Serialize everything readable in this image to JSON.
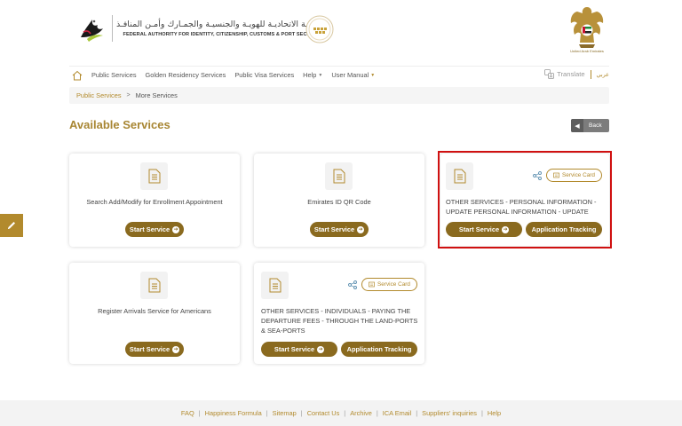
{
  "header": {
    "logo_arabic": "الهيئـة الاتحاديـة للهويـة والجنسيـة والجمـارك وأمـن المنافـذ",
    "logo_english": "FEDERAL AUTHORITY FOR IDENTITY, CITIZENSHIP, CUSTOMS & PORT SECURITY",
    "uae_label": "United Arab Emirates"
  },
  "nav": {
    "items": [
      {
        "label": "Public Services",
        "dropdown": false
      },
      {
        "label": "Golden Residency Services",
        "dropdown": false
      },
      {
        "label": "Public Visa Services",
        "dropdown": false
      },
      {
        "label": "Help",
        "dropdown": true
      },
      {
        "label": "User Manual",
        "dropdown": true
      }
    ],
    "translate": "Translate",
    "arabic": "عربي"
  },
  "breadcrumb": {
    "parent": "Public Services",
    "separator": ">",
    "current": "More Services"
  },
  "page_title": "Available Services",
  "back_label": "Back",
  "cards": [
    {
      "title": "Search Add/Modify for Enrollment Appointment",
      "start": "Start Service"
    },
    {
      "title": "Emirates ID QR Code",
      "start": "Start Service"
    },
    {
      "title": "OTHER SERVICES - PERSONAL INFORMATION - UPDATE PERSONAL INFORMATION - UPDATE",
      "start": "Start Service",
      "tracking": "Application Tracking",
      "service_card": "Service Card"
    },
    {
      "title": "Register Arrivals Service for Americans",
      "start": "Start Service"
    },
    {
      "title": "OTHER SERVICES - INDIVIDUALS - PAYING THE DEPARTURE FEES - THROUGH THE LAND-PORTS & SEA-PORTS",
      "start": "Start Service",
      "tracking": "Application Tracking",
      "service_card": "Service Card"
    }
  ],
  "footer": {
    "links": [
      "FAQ",
      "Happiness Formula",
      "Sitemap",
      "Contact Us",
      "Archive",
      "ICA Email",
      "Suppliers' inquiries",
      "Help"
    ]
  },
  "colors": {
    "gold": "#b28a2d",
    "button": "#8a6a1f",
    "highlight": "#d01010"
  }
}
